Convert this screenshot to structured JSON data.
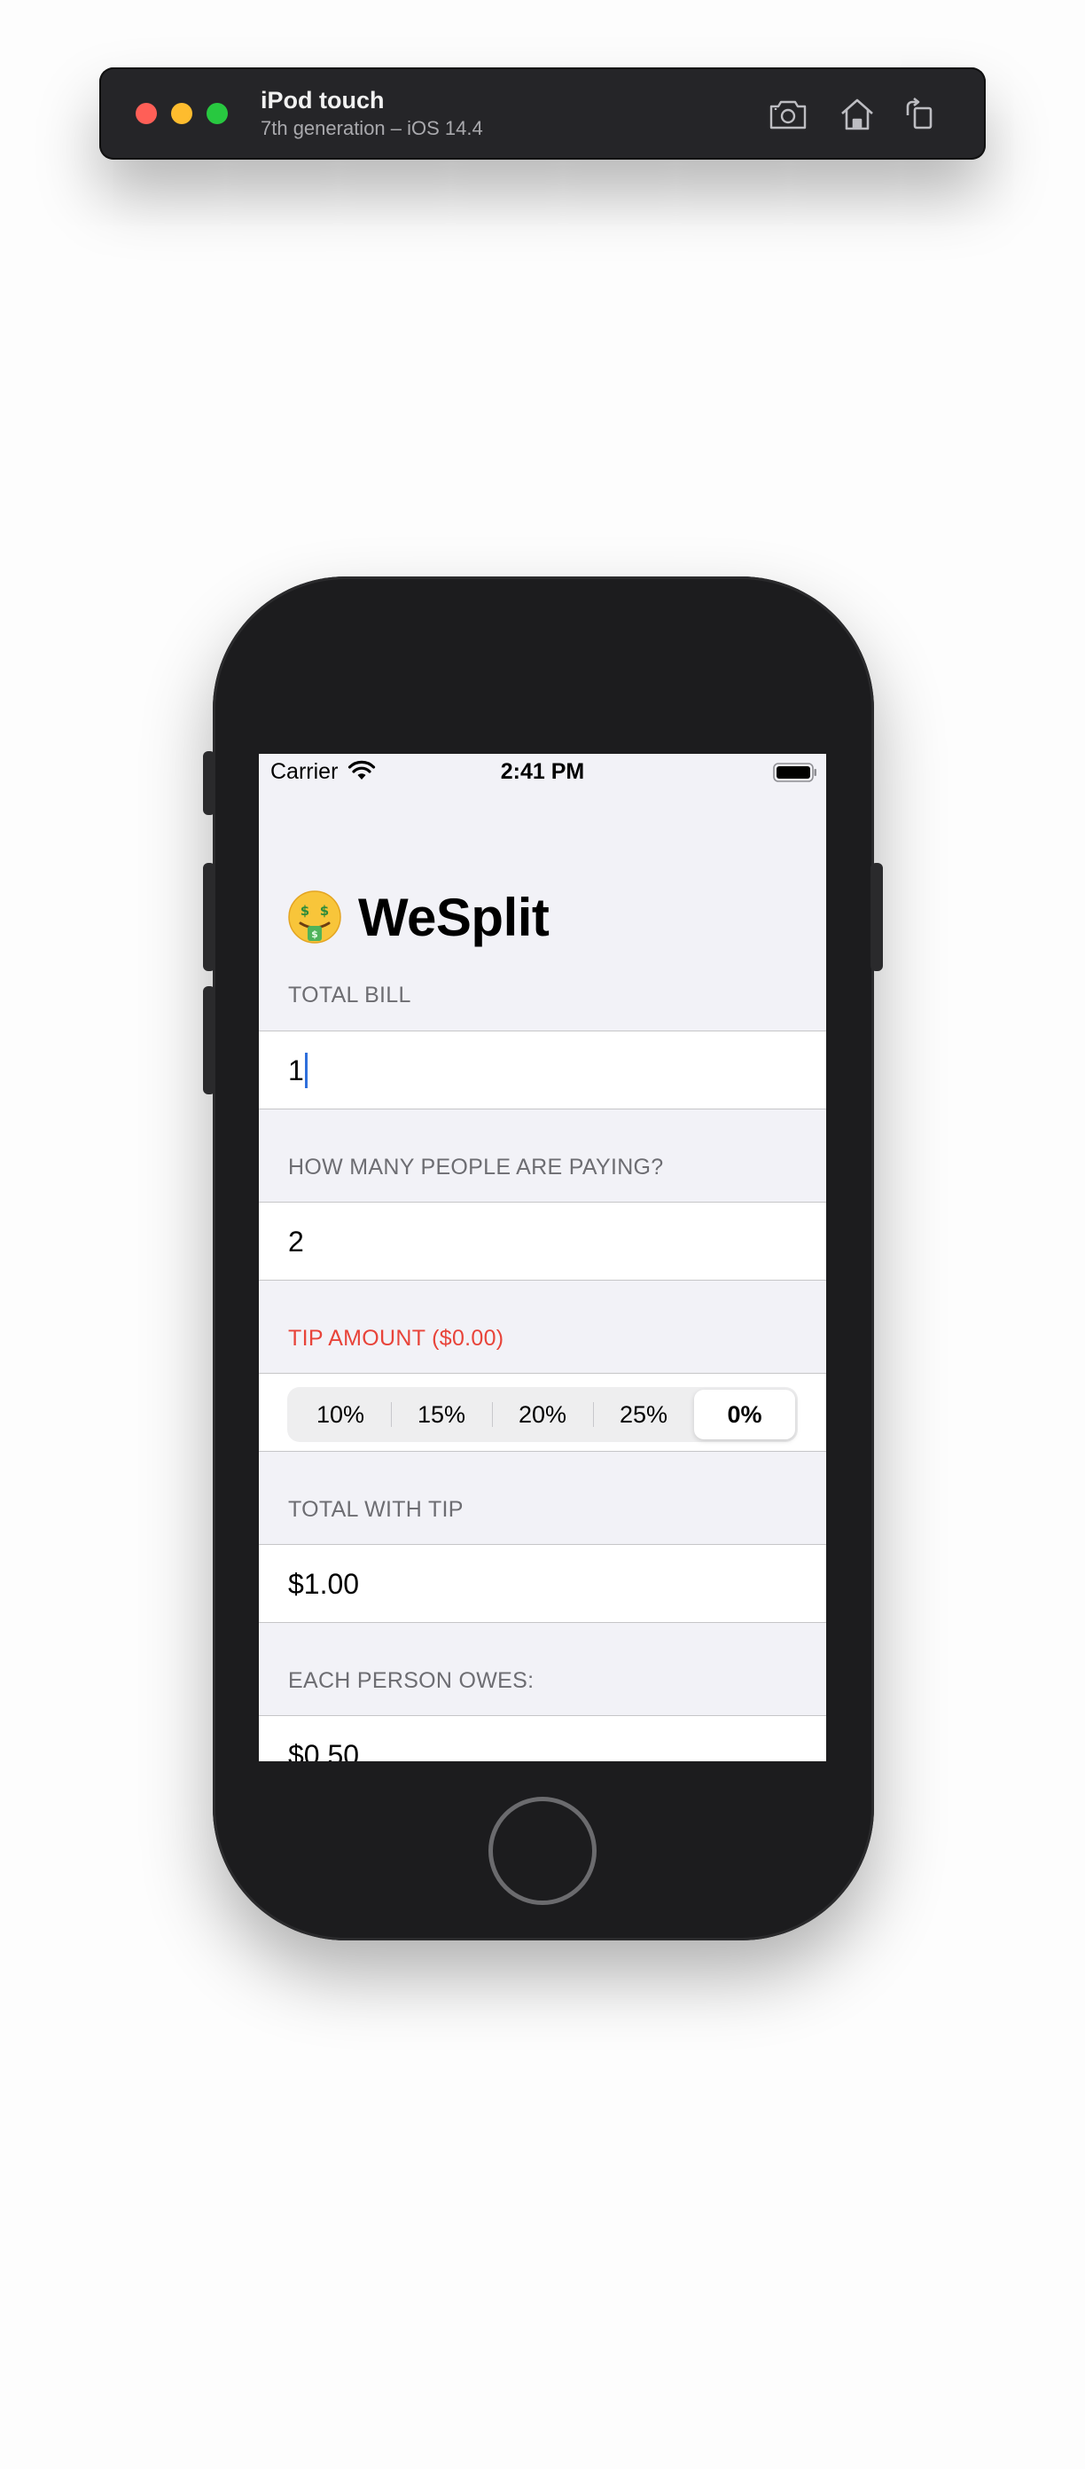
{
  "simulator": {
    "device_name": "iPod touch",
    "device_detail": "7th generation – iOS 14.4",
    "icons": [
      "screenshot-icon",
      "home-icon",
      "rotate-icon"
    ]
  },
  "status_bar": {
    "carrier": "Carrier",
    "time": "2:41 PM"
  },
  "app": {
    "title_emoji": "money-mouth-face-icon",
    "title": "WeSplit",
    "sections": {
      "total_bill": {
        "header": "TOTAL BILL",
        "value": "1"
      },
      "people": {
        "header": "HOW MANY PEOPLE ARE PAYING?",
        "value": "2"
      },
      "tip": {
        "header": "TIP AMOUNT ($0.00)",
        "options": [
          "10%",
          "15%",
          "20%",
          "25%",
          "0%"
        ],
        "selected": "0%"
      },
      "total_with_tip": {
        "header": "TOTAL WITH TIP",
        "value": "$1.00"
      },
      "each_owes": {
        "header": "EACH PERSON OWES:",
        "value": "$0.50"
      }
    }
  },
  "colors": {
    "tip_header": "#e8443a",
    "caret": "#2f6fdb",
    "background": "#f2f2f7"
  }
}
